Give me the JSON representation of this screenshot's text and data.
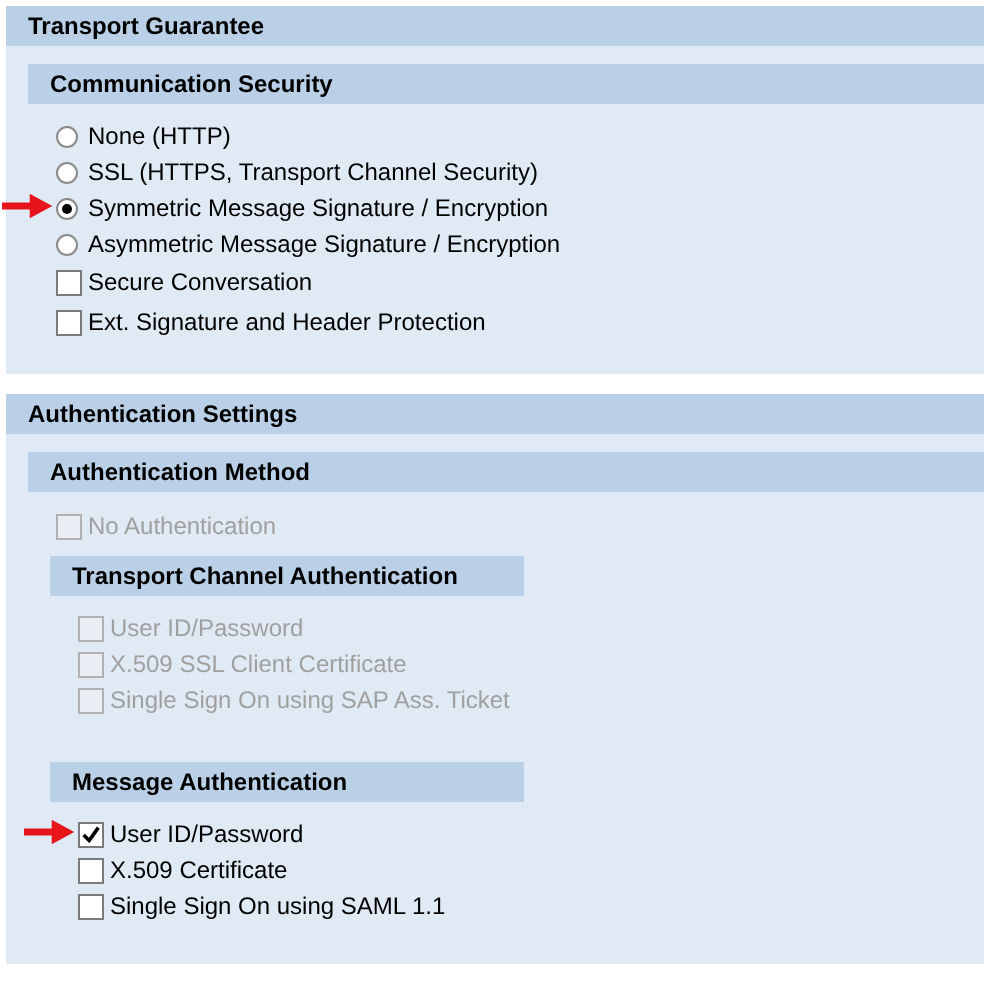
{
  "sections": [
    {
      "title": "Transport Guarantee",
      "groups": [
        {
          "title": "Communication Security",
          "items": [
            {
              "kind": "radio",
              "label": "None (HTTP)",
              "selected": false,
              "disabled": false,
              "marked": false
            },
            {
              "kind": "radio",
              "label": "SSL (HTTPS, Transport Channel Security)",
              "selected": false,
              "disabled": false,
              "marked": false
            },
            {
              "kind": "radio",
              "label": "Symmetric Message Signature / Encryption",
              "selected": true,
              "disabled": false,
              "marked": true
            },
            {
              "kind": "radio",
              "label": "Asymmetric Message Signature / Encryption",
              "selected": false,
              "disabled": false,
              "marked": false
            },
            {
              "kind": "checkbox",
              "label": "Secure Conversation",
              "checked": false,
              "disabled": false,
              "marked": false
            },
            {
              "kind": "checkbox",
              "label": "Ext. Signature and Header Protection",
              "checked": false,
              "disabled": false,
              "marked": false
            }
          ]
        }
      ]
    },
    {
      "title": "Authentication Settings",
      "groups": [
        {
          "title": "Authentication Method",
          "items": [
            {
              "kind": "checkbox",
              "label": "No Authentication",
              "checked": false,
              "disabled": true,
              "marked": false
            }
          ],
          "subgroups": [
            {
              "title": "Transport Channel Authentication",
              "items": [
                {
                  "kind": "checkbox",
                  "label": "User ID/Password",
                  "checked": false,
                  "disabled": true,
                  "marked": false
                },
                {
                  "kind": "checkbox",
                  "label": "X.509 SSL Client Certificate",
                  "checked": false,
                  "disabled": true,
                  "marked": false
                },
                {
                  "kind": "checkbox",
                  "label": "Single Sign On using SAP Ass. Ticket",
                  "checked": false,
                  "disabled": true,
                  "marked": false
                }
              ]
            },
            {
              "title": "Message Authentication",
              "items": [
                {
                  "kind": "checkbox",
                  "label": "User ID/Password",
                  "checked": true,
                  "disabled": false,
                  "marked": true
                },
                {
                  "kind": "checkbox",
                  "label": "X.509 Certificate",
                  "checked": false,
                  "disabled": false,
                  "marked": false
                },
                {
                  "kind": "checkbox",
                  "label": "Single Sign On using SAML 1.1",
                  "checked": false,
                  "disabled": false,
                  "marked": false
                }
              ]
            }
          ]
        }
      ]
    }
  ]
}
